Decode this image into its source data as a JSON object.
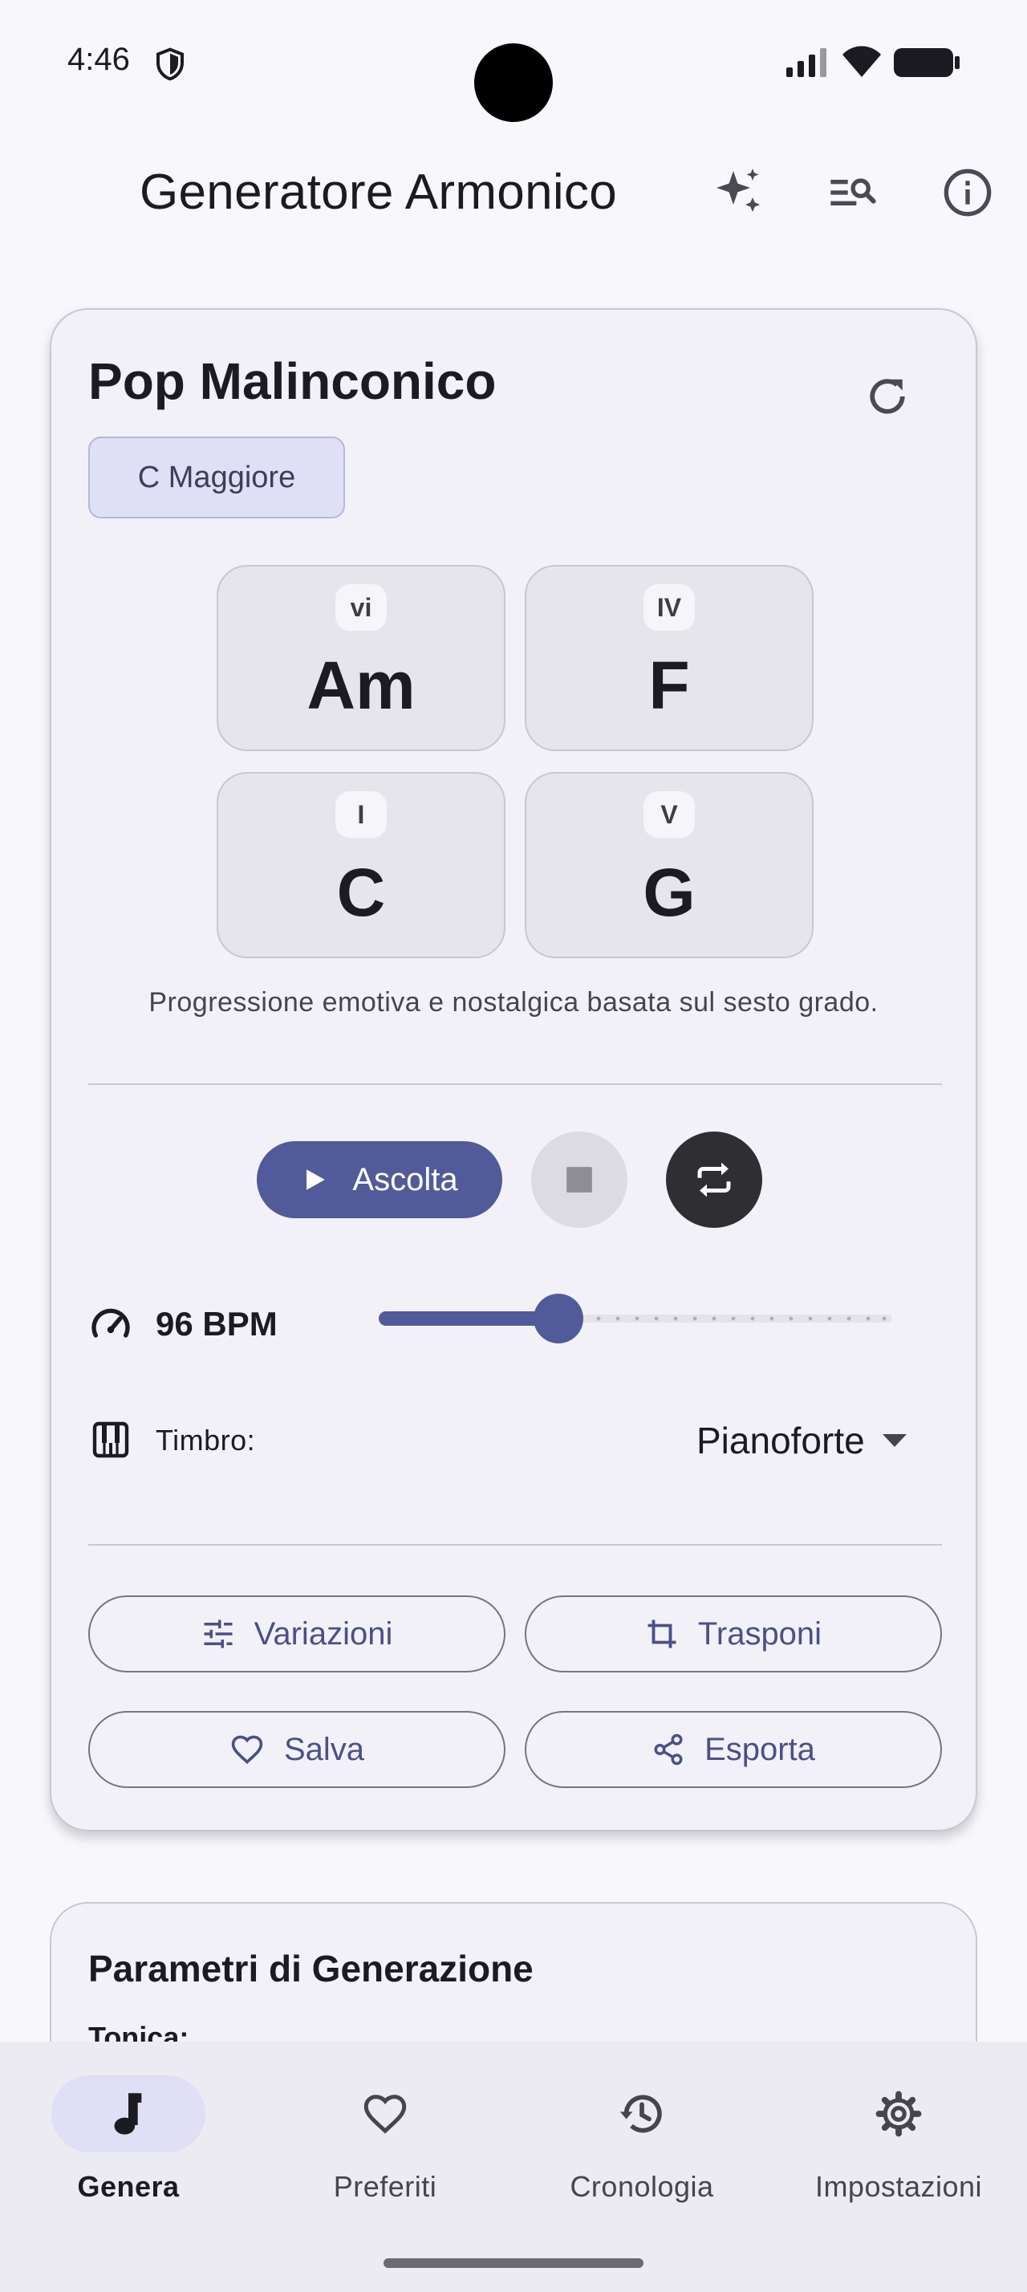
{
  "status_bar": {
    "time": "4:46"
  },
  "app_bar": {
    "title": "Generatore Armonico"
  },
  "progression": {
    "name": "Pop Malinconico",
    "key": "C Maggiore",
    "chords": [
      {
        "degree": "vi",
        "name": "Am"
      },
      {
        "degree": "IV",
        "name": "F"
      },
      {
        "degree": "I",
        "name": "C"
      },
      {
        "degree": "V",
        "name": "G"
      }
    ],
    "description": "Progressione emotiva e nostalgica basata sul sesto grado."
  },
  "playback": {
    "play_label": "Ascolta",
    "bpm_label": "96 BPM",
    "tempo_fraction": 0.35,
    "timbre_label": "Timbro:",
    "timbre_value": "Pianoforte"
  },
  "actions": {
    "variations": "Variazioni",
    "transpose": "Trasponi",
    "save": "Salva",
    "export": "Esporta"
  },
  "parameters": {
    "title": "Parametri di Generazione",
    "first_field": "Tonica:"
  },
  "bottom_nav": {
    "items": [
      {
        "label": "Genera",
        "icon": "music-note-icon",
        "active": true
      },
      {
        "label": "Preferiti",
        "icon": "heart-icon",
        "active": false
      },
      {
        "label": "Cronologia",
        "icon": "history-icon",
        "active": false
      },
      {
        "label": "Impostazioni",
        "icon": "gear-icon",
        "active": false
      }
    ]
  },
  "colors": {
    "primary": "#525b99",
    "chip_bg": "#dfe0f6",
    "card_bg": "#f3f1f8",
    "loop_button": "#2e2e33"
  }
}
